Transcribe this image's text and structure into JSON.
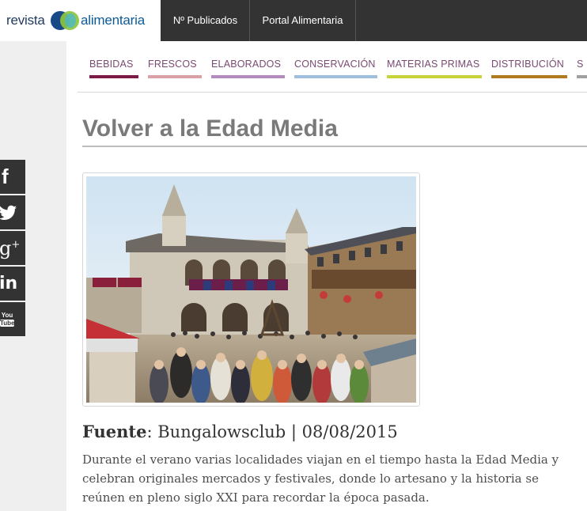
{
  "header": {
    "logo_left": "revista",
    "logo_right": "alimentaria",
    "nav": [
      "Nº Publicados",
      "Portal Alimentaria"
    ]
  },
  "categories": [
    {
      "label": "BEBIDAS",
      "color": "#7b1a45"
    },
    {
      "label": "FRESCOS",
      "color": "#d9a0a6"
    },
    {
      "label": "ELABORADOS",
      "color": "#b48ac0"
    },
    {
      "label": "CONSERVACIÓN",
      "color": "#9fbfde"
    },
    {
      "label": "MATERIAS PRIMAS",
      "color": "#c6d33a"
    },
    {
      "label": "DISTRIBUCIÓN",
      "color": "#b07a1e"
    },
    {
      "label": "S",
      "color": "#a0a0a0"
    }
  ],
  "social": [
    {
      "icon": "facebook-icon",
      "glyph": "f"
    },
    {
      "icon": "twitter-icon",
      "glyph": "🐦"
    },
    {
      "icon": "googleplus-icon",
      "glyph": "g+"
    },
    {
      "icon": "linkedin-icon",
      "glyph": "in"
    },
    {
      "icon": "youtube-icon",
      "glyph": "You Tube"
    }
  ],
  "article": {
    "title": "Volver a la Edad Media",
    "source_label": "Fuente",
    "source_value": ": Bungalowsclub | 08/08/2015",
    "lead": "Durante el verano varias localidades viajan en el tiempo hasta la Edad Media y celebran originales mercados y festivales, donde lo artesano y la historia se reúnen en pleno siglo XXI para recordar la época pasada."
  }
}
